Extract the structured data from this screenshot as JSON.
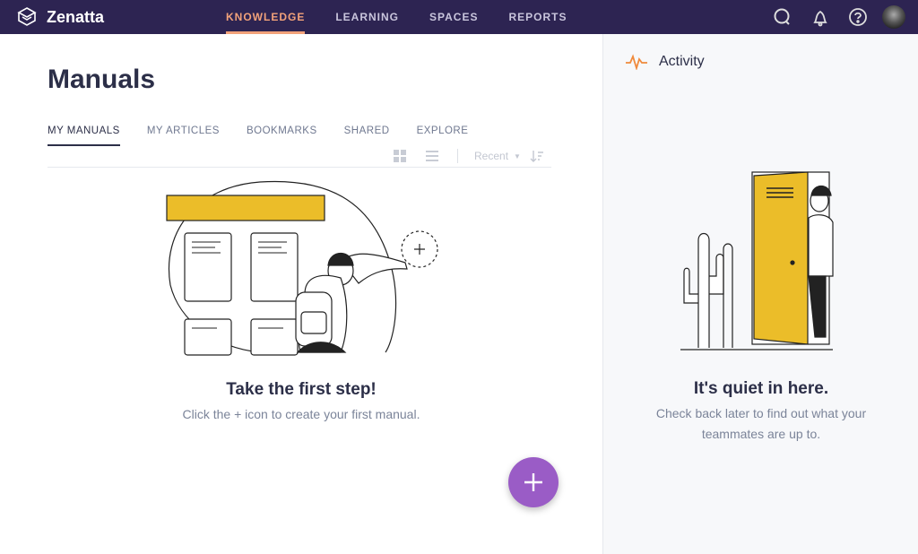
{
  "brand": {
    "name": "Zenatta"
  },
  "nav": [
    {
      "label": "KNOWLEDGE",
      "active": true
    },
    {
      "label": "LEARNING"
    },
    {
      "label": "SPACES"
    },
    {
      "label": "REPORTS"
    }
  ],
  "top_icons": [
    "search-icon",
    "bell-icon",
    "help-icon",
    "avatar"
  ],
  "colors": {
    "topbar": "#2d2452",
    "accent": "#f2a27a",
    "fab": "#9a5cc6",
    "yellow": "#ebbd29"
  },
  "main": {
    "title": "Manuals",
    "tabs": [
      {
        "label": "MY MANUALS",
        "active": true
      },
      {
        "label": "MY ARTICLES"
      },
      {
        "label": "BOOKMARKS"
      },
      {
        "label": "SHARED"
      },
      {
        "label": "EXPLORE"
      }
    ],
    "sort": {
      "selected": "Recent"
    },
    "empty_title": "Take the first step!",
    "empty_sub": "Click the + icon to create your first manual."
  },
  "activity": {
    "title": "Activity",
    "empty_title": "It's quiet in here.",
    "empty_sub": "Check back later to find out what your teammates are up to."
  }
}
